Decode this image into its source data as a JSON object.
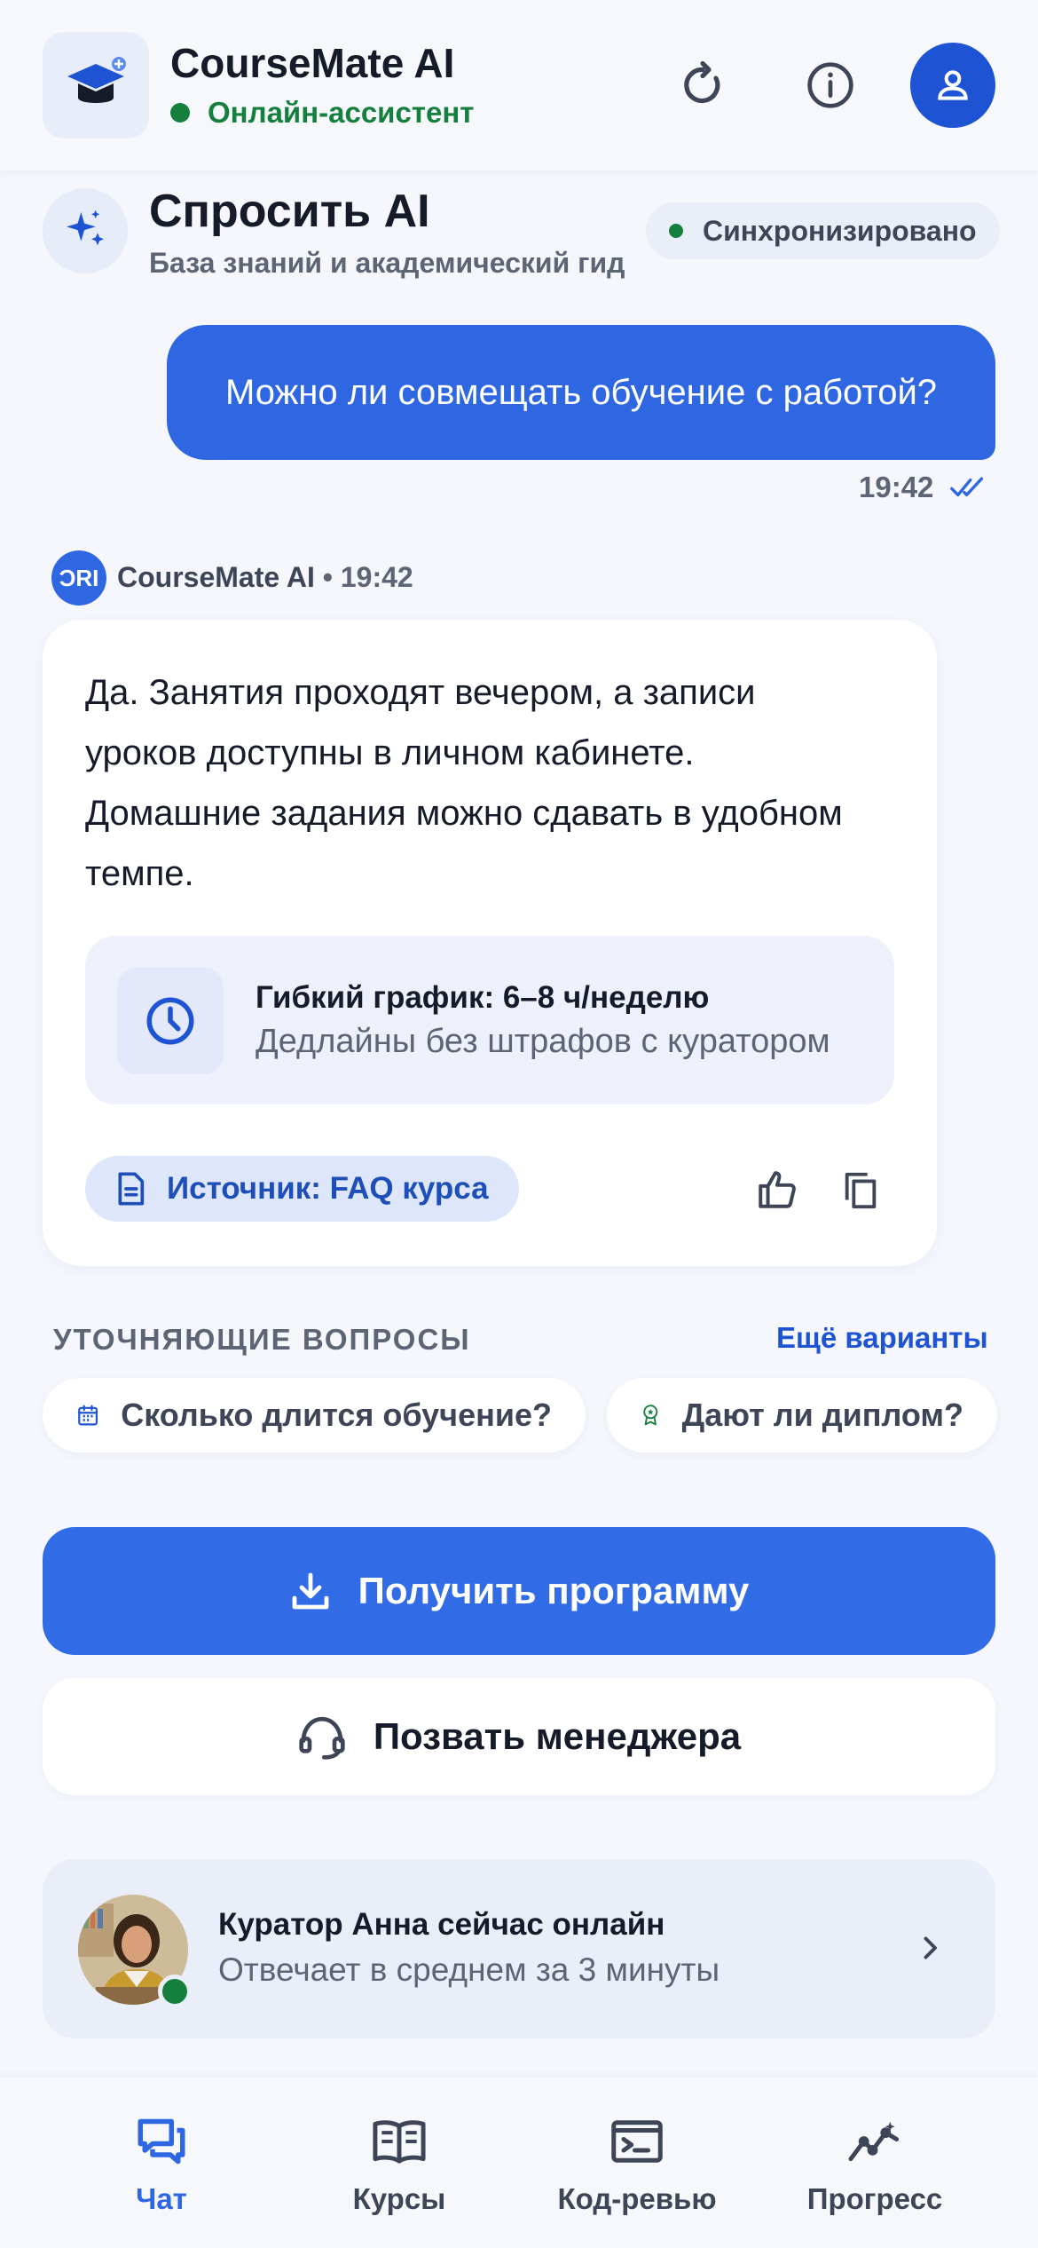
{
  "header": {
    "app_title": "CourseMate AI",
    "status": "Онлайн-ассистент",
    "icons": [
      "graduation-cap-icon",
      "refresh-icon",
      "info-icon",
      "profile-icon"
    ]
  },
  "ask": {
    "title": "Спросить AI",
    "subtitle": "База знаний и академический гид",
    "sync_status": "Синхронизировано"
  },
  "messages": {
    "user": {
      "text": "Можно ли совмещать обучение с работой?",
      "time": "19:42"
    },
    "ai": {
      "avatar_text": "ƆRI",
      "sender": "CourseMate AI",
      "time_sep": "• 19:42",
      "text": "Да. Занятия проходят вечером, а записи уроков доступны в личном кабинете. Домашние задания можно сдавать в удобном темпе.",
      "info_title": "Гибкий график: 6–8 ч/неделю",
      "info_subtitle": "Дедлайны без штрафов с куратором",
      "source": "Источник: FAQ курса"
    }
  },
  "followups": {
    "title": "УТОЧНЯЮЩИЕ ВОПРОСЫ",
    "more": "Ещё варианты",
    "chips": [
      {
        "label": "Сколько длится обучение?",
        "icon": "calendar-icon"
      },
      {
        "label": "Дают ли диплом?",
        "icon": "award-icon"
      }
    ]
  },
  "actions": {
    "primary": "Получить программу",
    "secondary": "Позвать менеджера"
  },
  "curator": {
    "name": "Куратор Анна сейчас онлайн",
    "subtitle": "Отвечает в среднем за 3 минуты"
  },
  "nav": {
    "items": [
      {
        "label": "Чат",
        "icon": "chat-icon",
        "active": true
      },
      {
        "label": "Курсы",
        "icon": "book-icon",
        "active": false
      },
      {
        "label": "Код-ревью",
        "icon": "terminal-icon",
        "active": false
      },
      {
        "label": "Прогресс",
        "icon": "progress-icon",
        "active": false
      }
    ]
  },
  "colors": {
    "accent": "#2f67e3",
    "primary_button": "#316be6",
    "online_green": "#15803d",
    "background": "#f5f7fd",
    "text_muted": "#5d6474"
  }
}
